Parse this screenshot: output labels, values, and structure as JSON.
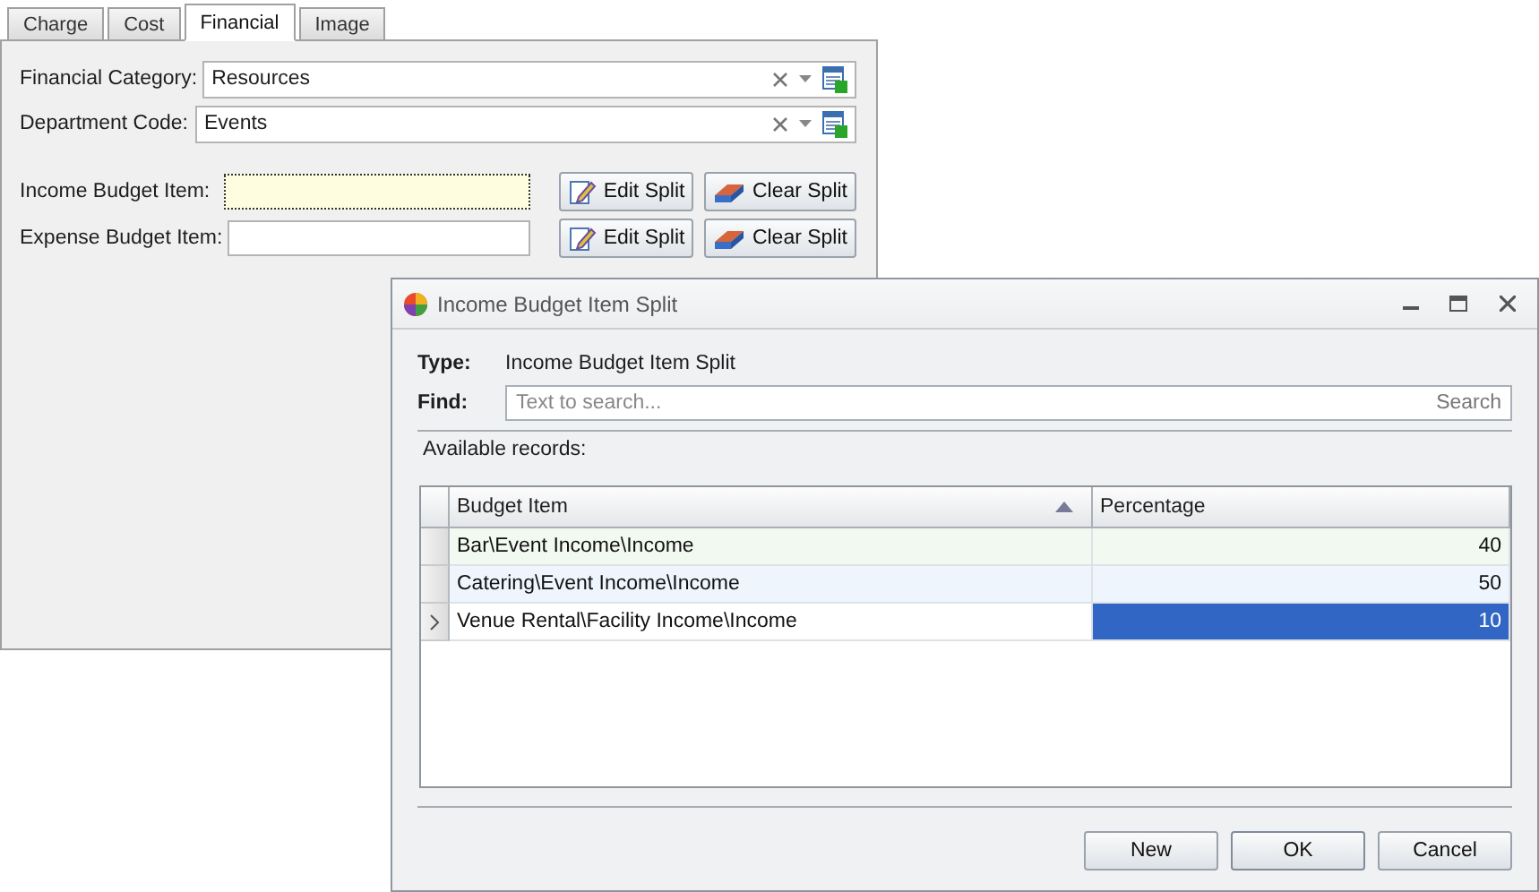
{
  "tabs": [
    {
      "label": "Charge",
      "selected": false
    },
    {
      "label": "Cost",
      "selected": false
    },
    {
      "label": "Financial",
      "selected": true
    },
    {
      "label": "Image",
      "selected": false
    }
  ],
  "lookups": [
    {
      "label": "Financial Category:",
      "value": "Resources"
    },
    {
      "label": "Department Code:",
      "value": "Events"
    }
  ],
  "budget_items": [
    {
      "label": "Income Budget Item:",
      "focused": true,
      "edit": "Edit Split",
      "clear": "Clear Split"
    },
    {
      "label": "Expense Budget Item:",
      "focused": false,
      "edit": "Edit Split",
      "clear": "Clear Split"
    }
  ],
  "dialog": {
    "title": "Income Budget Item Split",
    "type_label": "Type:",
    "type_value": "Income Budget Item Split",
    "find_label": "Find:",
    "find_placeholder": "Text to search...",
    "search": "Search",
    "records_label": "Available records:",
    "columns": [
      {
        "label": "Budget Item",
        "sorted": true
      },
      {
        "label": "Percentage",
        "sorted": false
      }
    ],
    "rows": [
      {
        "item": "Bar\\Event Income\\Income",
        "percentage": "40",
        "selected": false
      },
      {
        "item": "Catering\\Event Income\\Income",
        "percentage": "50",
        "selected": false
      },
      {
        "item": "Venue Rental\\Facility Income\\Income",
        "percentage": "10",
        "selected": true
      }
    ],
    "buttons": [
      "New",
      "OK",
      "Cancel"
    ]
  }
}
